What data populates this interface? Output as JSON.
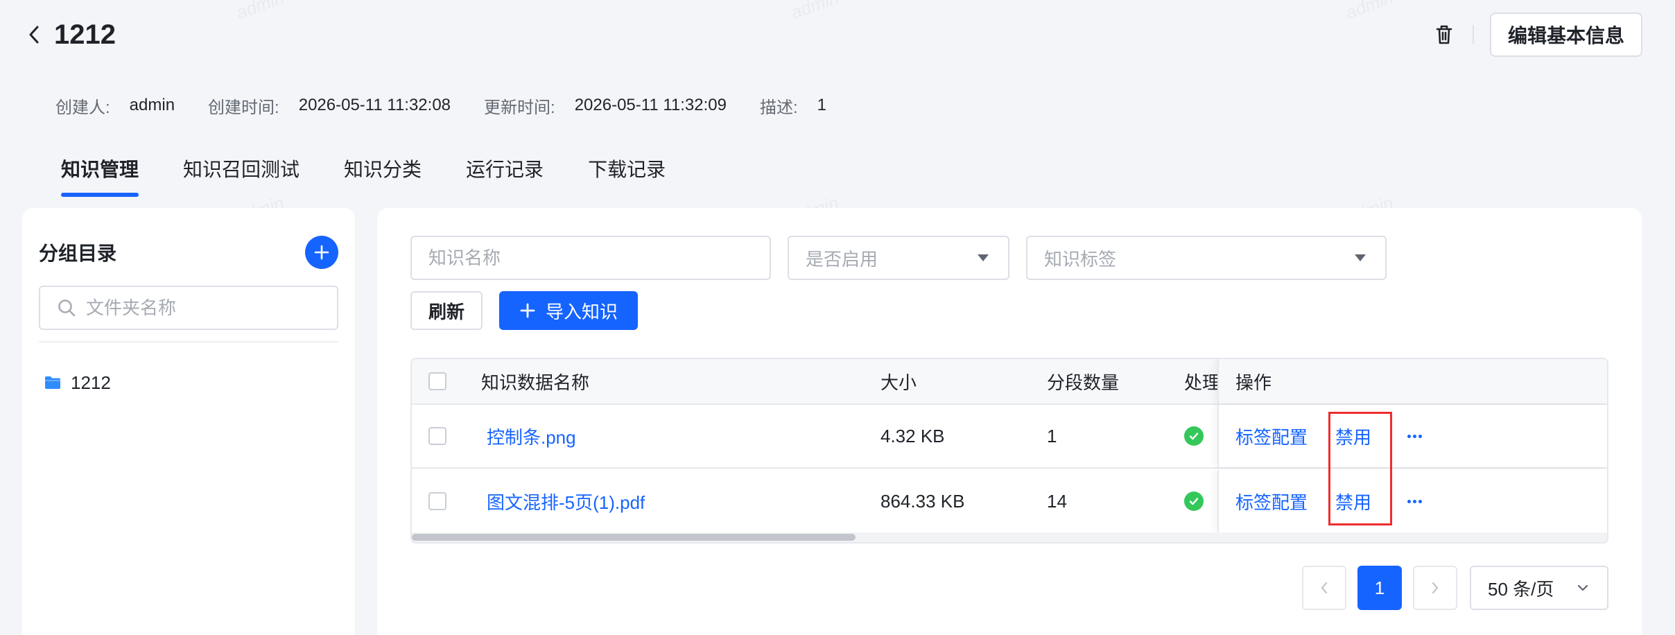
{
  "header": {
    "title": "1212",
    "edit_label": "编辑基本信息"
  },
  "meta": {
    "creator_label": "创建人:",
    "creator": "admin",
    "created_label": "创建时间:",
    "created": "2026-05-11 11:32:08",
    "updated_label": "更新时间:",
    "updated": "2026-05-11 11:32:09",
    "desc_label": "描述:",
    "desc": "1"
  },
  "tabs": [
    {
      "label": "知识管理",
      "active": true
    },
    {
      "label": "知识召回测试"
    },
    {
      "label": "知识分类"
    },
    {
      "label": "运行记录"
    },
    {
      "label": "下载记录"
    }
  ],
  "sidebar": {
    "title": "分组目录",
    "search_placeholder": "文件夹名称",
    "folders": [
      {
        "name": "1212"
      }
    ]
  },
  "filters": {
    "name_placeholder": "知识名称",
    "enabled_placeholder": "是否启用",
    "tag_placeholder": "知识标签"
  },
  "toolbar": {
    "refresh_label": "刷新",
    "import_label": "导入知识"
  },
  "table": {
    "columns": {
      "name": "知识数据名称",
      "size": "大小",
      "segments": "分段数量",
      "status": "处理",
      "ops": "操作"
    },
    "rows": [
      {
        "name": "控制条.png",
        "size": "4.32 KB",
        "segments": "1",
        "tag_config": "标签配置",
        "disable": "禁用"
      },
      {
        "name": "图文混排-5页(1).pdf",
        "size": "864.33 KB",
        "segments": "14",
        "tag_config": "标签配置",
        "disable": "禁用"
      }
    ]
  },
  "pagination": {
    "current": "1",
    "page_size": "50 条/页"
  },
  "watermark": "admin",
  "colors": {
    "accent": "#1664ff",
    "success": "#34c85a",
    "highlight": "#ef2c2c"
  }
}
